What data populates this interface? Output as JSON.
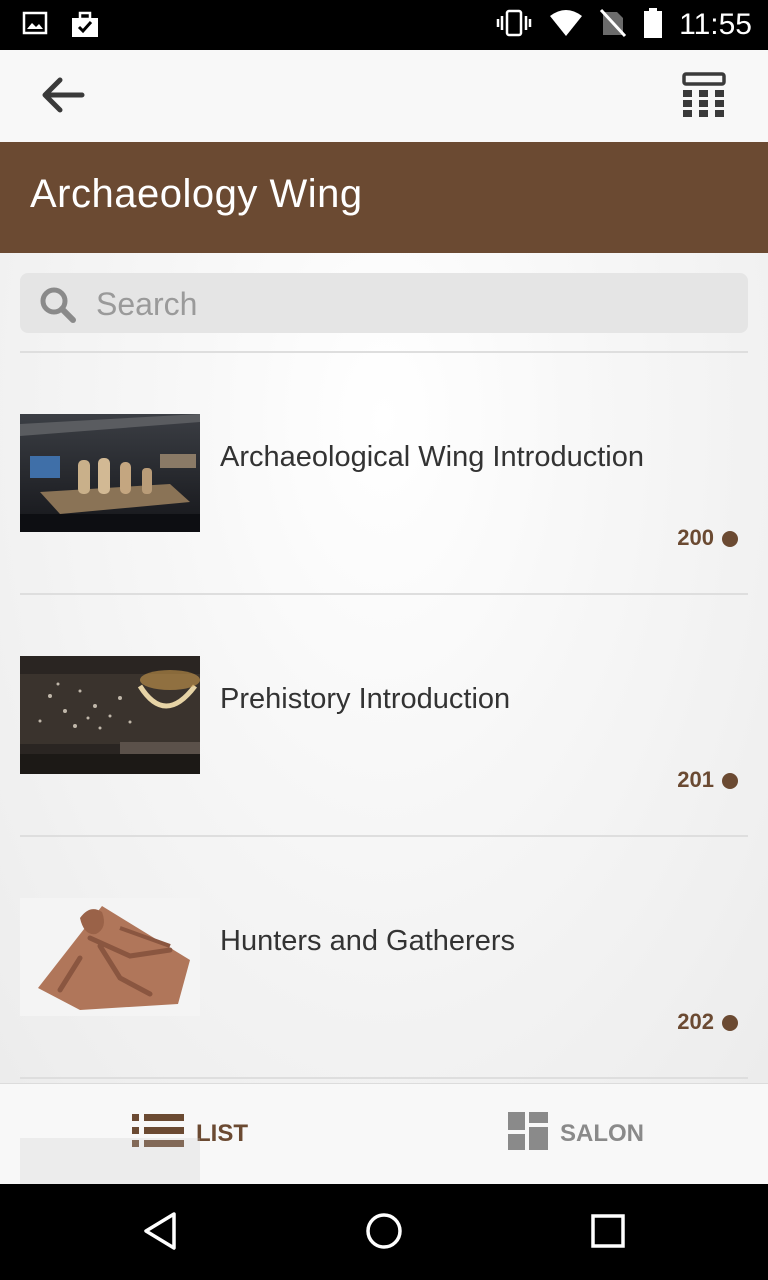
{
  "status_bar": {
    "time": "11:55",
    "left_icons": [
      "image-icon",
      "briefcase-check-icon"
    ],
    "right_icons": [
      "vibrate-icon",
      "wifi-icon",
      "no-sim-icon",
      "battery-icon"
    ]
  },
  "app_bar": {
    "back_icon": "arrow-left-icon",
    "keypad_icon": "keypad-icon"
  },
  "header": {
    "title": "Archaeology Wing"
  },
  "search": {
    "placeholder": "Search",
    "value": ""
  },
  "items": [
    {
      "title": "Archaeological Wing Introduction",
      "number": "200"
    },
    {
      "title": "Prehistory Introduction",
      "number": "201"
    },
    {
      "title": "Hunters and Gatherers",
      "number": "202"
    }
  ],
  "tabs": {
    "list_label": "LIST",
    "salon_label": "SALON",
    "active": "LIST"
  },
  "colors": {
    "brand": "#6b4a32",
    "inactive": "#8a8a8a"
  }
}
